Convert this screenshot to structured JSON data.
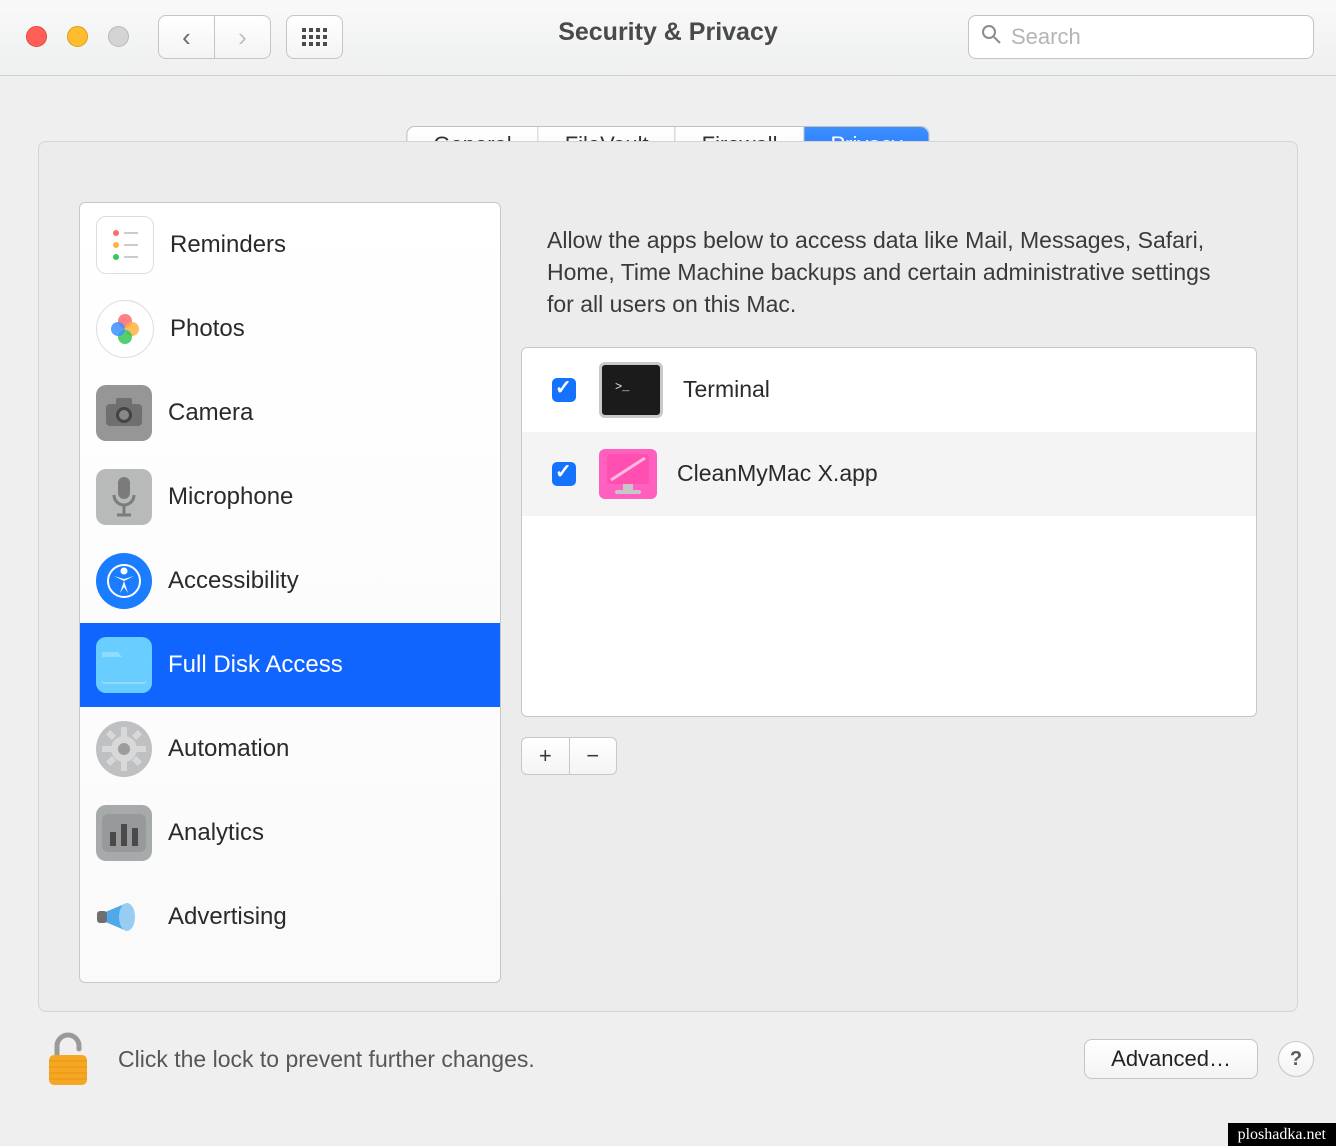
{
  "window_title": "Security & Privacy",
  "search": {
    "placeholder": "Search",
    "value": ""
  },
  "tabs": [
    "General",
    "FileVault",
    "Firewall",
    "Privacy"
  ],
  "active_tab": "Privacy",
  "sidebar_items": [
    {
      "label": "Reminders",
      "icon": "reminders-icon"
    },
    {
      "label": "Photos",
      "icon": "photos-icon"
    },
    {
      "label": "Camera",
      "icon": "camera-icon"
    },
    {
      "label": "Microphone",
      "icon": "microphone-icon"
    },
    {
      "label": "Accessibility",
      "icon": "accessibility-icon"
    },
    {
      "label": "Full Disk Access",
      "icon": "folder-icon",
      "selected": true
    },
    {
      "label": "Automation",
      "icon": "gear-icon"
    },
    {
      "label": "Analytics",
      "icon": "analytics-icon"
    },
    {
      "label": "Advertising",
      "icon": "advertising-icon"
    }
  ],
  "description": "Allow the apps below to access data like Mail, Messages, Safari, Home, Time Machine backups and certain administrative settings for all users on this Mac.",
  "apps": [
    {
      "name": "Terminal",
      "checked": true,
      "icon": "terminal-icon"
    },
    {
      "name": "CleanMyMac X.app",
      "checked": true,
      "icon": "cleanmymac-icon"
    }
  ],
  "add_label": "+",
  "remove_label": "−",
  "lock_text": "Click the lock to prevent further changes.",
  "advanced_label": "Advanced…",
  "help_label": "?",
  "watermark": "ploshadka.net"
}
